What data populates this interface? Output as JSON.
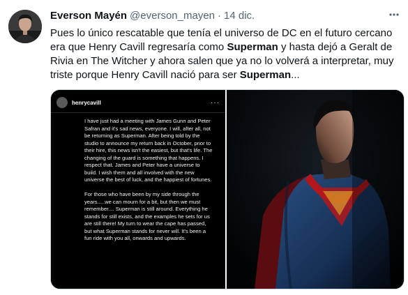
{
  "tweet": {
    "author": {
      "display_name": "Everson Mayén",
      "handle": "@everson_mayen",
      "separator": "·",
      "date": "14 dic."
    },
    "more_icon": "more-horizontal-icon",
    "text_parts": {
      "p1": "Pues lo único rescatable que tenía el universo de DC en el futuro cercano era que Henry Cavill regresaría como ",
      "b1": "Superman",
      "p2": " y hasta dejó a Geralt de Rivia en The Witcher y ahora salen que ya no lo volverá a interpretar, muy triste porque Henry Cavill nació para ser ",
      "b2": "Superman",
      "p3": "..."
    },
    "media": {
      "left": {
        "username": "henrycavill",
        "more": "···",
        "paragraphs": [
          "I have just had a meeting with James Gunn and Peter Safran and it's sad news, everyone. I will, after all, not be returning as Superman. After being told by the studio to announce my return back in October, prior to their hire, this news isn't the easiest, but that's life. The changing of the guard is something that happens. I respect that. James and Peter have a universe to build. I wish them and all involved with the new universe the best of luck, and the happiest of fortunes.",
          "For those who have been by my side through the years.....we can mourn for a bit, but then we must remember.... Superman is still around. Everything he stands for still exists, and the examples he sets for us are still there! My turn to wear the cape has passed, but what Superman stands for never will. It's been a fun ride with you all, onwards and upwards."
        ]
      },
      "right": {
        "subject": "superman-photo"
      }
    }
  },
  "colors": {
    "text_primary": "#0f1419",
    "text_secondary": "#536471",
    "suit_blue": "#1f3f6b",
    "cape_red": "#b4171b"
  }
}
